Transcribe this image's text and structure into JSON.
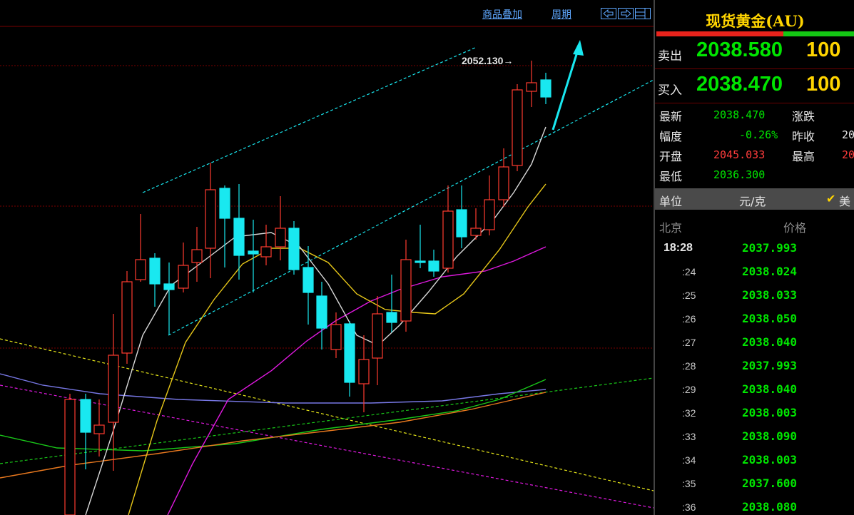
{
  "toolbar": {
    "overlay_label": "商品叠加",
    "period_label": "周期"
  },
  "chart": {
    "high_marker": "2052.130→"
  },
  "panel": {
    "title": "现货黄金(AU)",
    "sell": {
      "label": "卖出",
      "price": "2038.580",
      "volume": "100"
    },
    "buy": {
      "label": "买入",
      "price": "2038.470",
      "volume": "100"
    },
    "stats": [
      {
        "label": "最新",
        "value": "2038.470",
        "color": "#00e600"
      },
      {
        "label": "涨跌",
        "value": "",
        "color": "#00e600"
      },
      {
        "label": "幅度",
        "value": "-0.26%",
        "color": "#00e600"
      },
      {
        "label": "昨收",
        "value": "20",
        "color": "#e6e6e6"
      },
      {
        "label": "开盘",
        "value": "2045.033",
        "color": "#ff3c3c"
      },
      {
        "label": "最高",
        "value": "20",
        "color": "#ff3c3c"
      },
      {
        "label": "最低",
        "value": "2036.300",
        "color": "#00e600"
      }
    ],
    "unit": {
      "label": "单位",
      "value": "元/克",
      "check": "✔",
      "currency": "美"
    },
    "ticks_header": {
      "location": "北京",
      "price": "价格"
    },
    "ticks": [
      {
        "time": "18:28",
        "price": "2037.993"
      },
      {
        "time": ":24",
        "price": "2038.024"
      },
      {
        "time": ":25",
        "price": "2038.033"
      },
      {
        "time": ":26",
        "price": "2038.050"
      },
      {
        "time": ":27",
        "price": "2038.040"
      },
      {
        "time": ":28",
        "price": "2037.993"
      },
      {
        "time": ":29",
        "price": "2038.040"
      },
      {
        "time": ":32",
        "price": "2038.003"
      },
      {
        "time": ":33",
        "price": "2038.090"
      },
      {
        "time": ":34",
        "price": "2038.003"
      },
      {
        "time": ":35",
        "price": "2037.600"
      },
      {
        "time": ":36",
        "price": "2038.080"
      }
    ]
  },
  "colors": {
    "up": "#ff3b30",
    "down": "#19e8f0",
    "ma5": "#d8d8d8",
    "ma10": "#e6c619",
    "ma20": "#e019e0",
    "ma_long_green": "#19c819",
    "ma_long_orange": "#e8781e",
    "ma_long_blue": "#7878e6",
    "channel": "#19e8f0"
  }
}
